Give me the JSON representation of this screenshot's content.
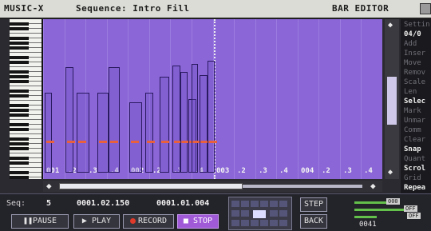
{
  "titlebar": {
    "app": "MUSIC-X",
    "sequence": "Sequence: Intro Fill",
    "editor": "BAR EDITOR"
  },
  "side_menu": [
    {
      "label": "Settin",
      "style": "dim"
    },
    {
      "label": "04/0",
      "style": "hi"
    },
    {
      "label": "Add",
      "style": "dim"
    },
    {
      "label": "Inser",
      "style": "dim"
    },
    {
      "label": "Move",
      "style": "dim"
    },
    {
      "label": "Remov",
      "style": "dim"
    },
    {
      "label": "Scale",
      "style": "dim"
    },
    {
      "label": "Len",
      "style": "dim"
    },
    {
      "label": "Selec",
      "style": "hi"
    },
    {
      "label": "Mark",
      "style": "dim"
    },
    {
      "label": "Unmar",
      "style": "dim"
    },
    {
      "label": "Comm",
      "style": "dim"
    },
    {
      "label": "Clear",
      "style": "dim"
    },
    {
      "label": "Snap",
      "style": "hi"
    },
    {
      "label": "Quant",
      "style": "dim"
    },
    {
      "label": "Scrol",
      "style": "hi"
    },
    {
      "label": "Grid",
      "style": "dim"
    },
    {
      "label": "Repea",
      "style": "hi"
    }
  ],
  "grid": {
    "beat_labels": [
      "001",
      ".2",
      ".3",
      ".4",
      "002",
      ".2",
      ".3",
      ".4",
      "003",
      ".2",
      ".3",
      ".4",
      "004",
      ".2",
      ".3",
      ".4"
    ]
  },
  "transport": {
    "seq_label": "Seq:",
    "seq_value": "5",
    "position_value": "0001.02.150",
    "position_value2": "0001.01.004",
    "pause_label": "PAUSE",
    "play_label": "PLAY",
    "record_label": "RECORD",
    "stop_label": "STOP",
    "step_label": "STEP",
    "back_label": "BACK"
  },
  "levels": {
    "tag1": "000",
    "tag2": "OFF",
    "tag3": "OFF",
    "number": "0041"
  },
  "colors": {
    "grid_bg": "#8a66d6",
    "velocity": "#e8603c",
    "stop_button": "#a05ad8",
    "level_meter": "#63c04a"
  }
}
